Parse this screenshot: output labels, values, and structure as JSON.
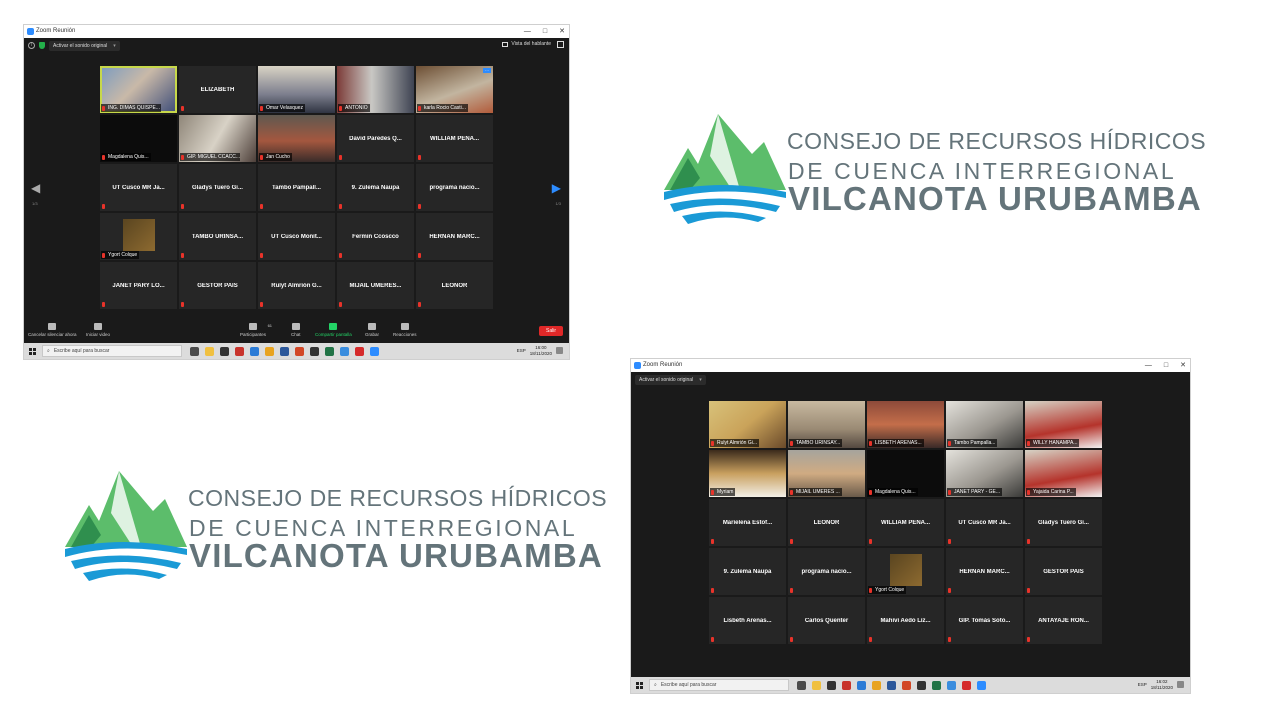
{
  "colors": {
    "zoom_bg": "#1a1a1a",
    "tile_bg": "#262626",
    "active_speaker": "#c7d84a",
    "share_green": "#23d366",
    "leave_red": "#e02828",
    "zoom_blue": "#2d8cff",
    "logo_text": "#64747a",
    "logo_green": "#5cbd6b",
    "logo_blue": "#1a9ad6"
  },
  "logo": {
    "line1": "CONSEJO DE RECURSOS HÍDRICOS",
    "line2": "DE CUENCA INTERREGIONAL",
    "line3": "VILCANOTA URUBAMBA"
  },
  "screen1": {
    "title": "Zoom Reunión",
    "window_controls": [
      "—",
      "□",
      "✕"
    ],
    "original_sound": "Activar el sonido original",
    "speaker_view": "Vista del hablante",
    "page_left": "1/3",
    "page_right": "1/3",
    "tiles": [
      {
        "name": "ING. DIMAS QUISPE...",
        "video": "vid-1",
        "active": true
      },
      {
        "name": "ELIZABETH",
        "video": ""
      },
      {
        "name": "Omar Velasquez",
        "video": "vid-2"
      },
      {
        "name": "ANTONIO",
        "video": "vid-3"
      },
      {
        "name": "karla Rocio Casti...",
        "video": "vid-4",
        "more": true
      },
      {
        "name": "Magdalena Quis...",
        "video": "vid-5"
      },
      {
        "name": "GIP. MIGUEL CCACC...",
        "video": "vid-6"
      },
      {
        "name": "Jan Cucho",
        "video": "vid-7"
      },
      {
        "name": "David Paredes Q...",
        "video": ""
      },
      {
        "name": "WILLIAM  PEÑA...",
        "video": ""
      },
      {
        "name": "UT Cusco MR Ja...",
        "video": ""
      },
      {
        "name": "Gladys Tuero Gi...",
        "video": ""
      },
      {
        "name": "Tambo Pampall...",
        "video": ""
      },
      {
        "name": "9. Zulema Ñaupa",
        "video": ""
      },
      {
        "name": "programa  nacio...",
        "video": ""
      },
      {
        "name": "Ygort Colque",
        "video": "",
        "thumb": true
      },
      {
        "name": "TAMBO URINSA...",
        "video": ""
      },
      {
        "name": "UT Cusco Monit...",
        "video": ""
      },
      {
        "name": "Fermin Ccoscco",
        "video": ""
      },
      {
        "name": "HERNAN  MARC...",
        "video": ""
      },
      {
        "name": "JANET PARY LO...",
        "video": ""
      },
      {
        "name": "GESTOR PAIS",
        "video": ""
      },
      {
        "name": "Rulyt Almrión G...",
        "video": ""
      },
      {
        "name": "MIJAIL  UMERES...",
        "video": ""
      },
      {
        "name": "LEONOR",
        "video": ""
      }
    ],
    "toolbar": {
      "mute": "Cancelar silenciar ahora",
      "video": "Iniciar video",
      "participants": "Participantes",
      "participants_count": "61",
      "chat": "Chat",
      "share": "Compartir pantalla",
      "record": "Grabar",
      "reactions": "Reacciones",
      "leave": "Salir"
    },
    "taskbar": {
      "search": "Escribe aquí para buscar",
      "lang": "ESP",
      "time": "16:00",
      "date": "18/11/2020"
    }
  },
  "screen2": {
    "title": "Zoom Reunión",
    "window_controls": [
      "—",
      "□",
      "✕"
    ],
    "original_sound": "Activar el sonido original",
    "tiles": [
      {
        "name": "Rulyt Almrión Gi...",
        "video": "vid-8"
      },
      {
        "name": "TAMBO URINSAY...",
        "video": "vid-9"
      },
      {
        "name": "LISBETH ARENAS...",
        "video": "vid-10"
      },
      {
        "name": "Tambo Pampalla...",
        "video": "vid-11"
      },
      {
        "name": "WILLY HANAMPA...",
        "video": "vid-12"
      },
      {
        "name": "Myriam",
        "video": "vid-13"
      },
      {
        "name": "MIJAIL UMERES ...",
        "video": "vid-14"
      },
      {
        "name": "Magdalena Quis...",
        "video": "vid-5"
      },
      {
        "name": "JANET PARY - GE...",
        "video": "vid-11"
      },
      {
        "name": "Yajaida Carina P...",
        "video": "vid-12"
      },
      {
        "name": "Marielena  Estof...",
        "video": ""
      },
      {
        "name": "LEONOR",
        "video": ""
      },
      {
        "name": "WILLIAM  PEÑA...",
        "video": ""
      },
      {
        "name": "UT Cusco MR Ja...",
        "video": ""
      },
      {
        "name": "Gladys Tuero Gi...",
        "video": ""
      },
      {
        "name": "9. Zulema Ñaupa",
        "video": ""
      },
      {
        "name": "programa  nacio...",
        "video": ""
      },
      {
        "name": "Ygort Colque",
        "video": "",
        "thumb": true
      },
      {
        "name": "HERNAN  MARC...",
        "video": ""
      },
      {
        "name": "GESTOR PAIS",
        "video": ""
      },
      {
        "name": "Lisbeth Arenas...",
        "video": ""
      },
      {
        "name": "Carlos Quenter",
        "video": ""
      },
      {
        "name": "Mahivi Aedo Liz...",
        "video": ""
      },
      {
        "name": "GIP. Tomás Soto...",
        "video": ""
      },
      {
        "name": "ANTAYAJE RON...",
        "video": ""
      }
    ],
    "taskbar": {
      "search": "Escribe aquí para buscar",
      "lang": "ESP",
      "time": "16:02",
      "date": "18/11/2020"
    }
  }
}
